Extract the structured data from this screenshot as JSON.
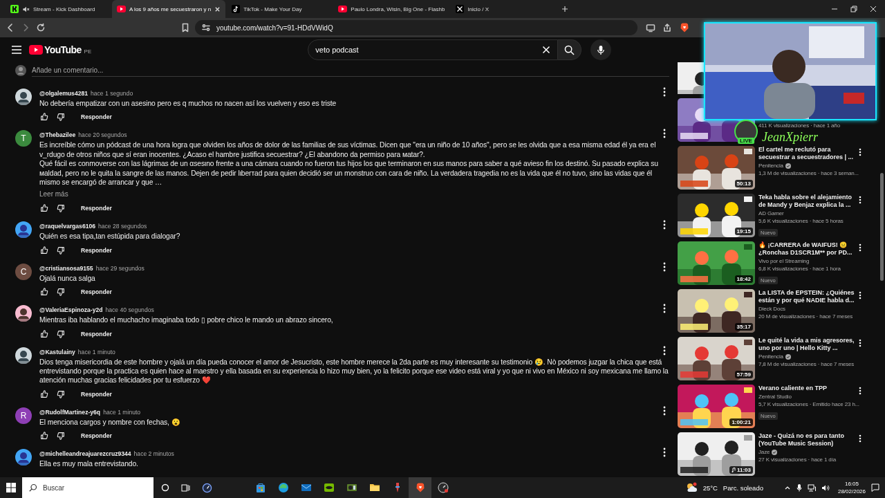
{
  "browser": {
    "tabs": [
      {
        "title": "Stream - Kick Dashboard",
        "kind": "kick",
        "muted": true,
        "selected": false
      },
      {
        "title": "A los 9 años me secuestraron y n",
        "kind": "youtube",
        "muted": false,
        "selected": true
      },
      {
        "title": "TikTok - Make Your Day",
        "kind": "tiktok",
        "muted": false,
        "selected": false
      },
      {
        "title": "Paulo Londra, Wisin, Big One - Flashb",
        "kind": "youtube",
        "muted": false,
        "selected": false
      },
      {
        "title": "Inicio / X",
        "kind": "x",
        "muted": false,
        "selected": false
      }
    ],
    "address": "youtube.com/watch?v=91-HDdVWidQ"
  },
  "youtube": {
    "logo": {
      "text": "YouTube",
      "region": "PE"
    },
    "search": {
      "value": "veto podcast"
    },
    "comment_box": {
      "placeholder": "Añade un comentario..."
    },
    "comments": [
      {
        "author": "@olgalemus4281",
        "time": "hace 1 segundo",
        "text": "No debería empatizar con un asesino pero es q muchos no nacen así los vuelven y eso es triste",
        "reply": "Responder"
      },
      {
        "author": "@Thebazilee",
        "time": "hace 20 segundos",
        "text": "Es increíble cómo un pódcast de una hora logra que olviden los años de dolor de las familias de sus víctimas. Dicen que \"era un niño de 10 años\", pero se les olvida que a esa misma edad él ya era el v_rdugo de otros niños que sí eran inocentes. ¿Acaso el hambre justifica ѕecuеstrar? ¿El abandono da permiso para маtаr?.\nQué fácil es conmoverse con las lágrimas de un αsesιno frente a una cámara cuando no fueron tus hijos los que terminaron en sus manos para saber a qué avieso fin los destinó. Su pasado explica su мaldad, pero no le quita la ѕangre de las manos. Dejen de pedir lιberтad para quien decidió ser un monstruo con cara de niño. La verdadera tragedia no es la vida que él no tuvo, sino las vidas que él mismo se encargó de arrancar y que …",
        "more": "Leer más",
        "avatar": {
          "kind": "letter",
          "letter": "T",
          "color": "#3b8a3e"
        },
        "reply": "Responder"
      },
      {
        "author": "@raquelvargas6106",
        "time": "hace 28 segundos",
        "text": "Quién es esa tipa,tan estúpida para dialogar?",
        "reply": "Responder"
      },
      {
        "author": "@cristiansosa9155",
        "time": "hace 29 segundos",
        "text": "Ojalá nunca salga",
        "avatar": {
          "kind": "letter",
          "letter": "C",
          "color": "#6d4c41"
        },
        "reply": "Responder"
      },
      {
        "author": "@ValeriaEspinoza-y2d",
        "time": "hace 40 segundos",
        "text": "Mientras iba hablando el muchacho  imaginaba todo ▯ pobre chico le mando un abrazo sincero,",
        "reply": "Responder"
      },
      {
        "author": "@Kastulainy",
        "time": "hace 1 minuto",
        "text": "Dios tenga misericordia de este hombre y ojalá un día pueda conocer el amor de Jesucristo,  este hombre merece la 2da parte es muy interesante su testimonio 😢.  Nò podemos juzgar la chica que está entrevistando porque la practica es quien hace al maestro y ella basada en su experiencia lo hizo muy bien, yo la felicito porque ese video está viral y yo que ni vivo en México ni soy mexicana me llamo la atención muchas gracias felicidades por tu esfuerzo ❤️",
        "reply": "Responder"
      },
      {
        "author": "@RudolfMartinez-y6q",
        "time": "hace 1 minuto",
        "text": "El menciona cargos y nombre con fechas, 😮",
        "avatar": {
          "kind": "letter",
          "letter": "R",
          "color": "#8e3fb5"
        },
        "reply": "Responder"
      },
      {
        "author": "@michelleandreajuarezcruz9344",
        "time": "hace 2 minutos",
        "text": "Ella es muy mala entrevistando."
      }
    ]
  },
  "sidebar": {
    "videos": [
      {
        "stats": "411 K visualizaciones · hace 1 año"
      },
      {
        "title": "El cartel me reclutó para secuestrar a secuestradores | ...",
        "channel": "Penitencia",
        "verified": true,
        "stats": "1,3 M de visualizaciones · hace 3 seman...",
        "duration": "50:13"
      },
      {
        "title": "Teka habla sobre el alejamiento de Mandy y Benjaz explica la ...",
        "channel": "AD Gamer",
        "verified": false,
        "stats": "5,6 K visualizaciones · hace 5 horas",
        "duration": "19:15",
        "badge": "Nuevo"
      },
      {
        "title": "🔥 ¡CARRERA de WAIFUS! 😐 ¿Ronchas D1SCR1M** por PD...",
        "channel": "Vivo por el Streaming",
        "verified": false,
        "stats": "6,8 K visualizaciones · hace 1 hora",
        "duration": "18:42",
        "badge": "Nuevo"
      },
      {
        "title": "La LISTA de EPSTEIN: ¿Quiénes están y por qué NADIE habla d...",
        "channel": "Dieck Docs",
        "verified": false,
        "stats": "20 M de visualizaciones · hace 7 meses",
        "duration": "35:17"
      },
      {
        "title": "Le quité la vida a mis agresores, uno por uno | Hello Kitty ...",
        "channel": "Penitencia",
        "verified": true,
        "stats": "7,8 M de visualizaciones · hace 7 meses",
        "duration": "57:59"
      },
      {
        "title": "Verano caliente en TPP",
        "channel": "Zentral Studio",
        "verified": false,
        "stats": "5,7 K visualizaciones · Emitido hace 23 h...",
        "duration": "1:00:21",
        "badge": "Nuevo"
      },
      {
        "title": "Jaze - Quizá no es para tanto (YouTube Music Session)",
        "channel": "Jaze",
        "verified": true,
        "stats": "27 K visualizaciones · hace 1 día",
        "duration": "11:03",
        "music": true
      }
    ]
  },
  "stream_overlay": {
    "name": "JeanXpierr",
    "badge": "LIVE"
  },
  "taskbar": {
    "search_placeholder": "Buscar",
    "apps": [
      {
        "kind": "store",
        "selected": false
      },
      {
        "kind": "edge",
        "selected": false
      },
      {
        "kind": "mail",
        "selected": false
      },
      {
        "kind": "nvidia",
        "selected": false
      },
      {
        "kind": "gpu",
        "selected": false
      },
      {
        "kind": "folder",
        "selected": false
      },
      {
        "kind": "tool",
        "selected": false
      },
      {
        "kind": "brave",
        "selected": true
      },
      {
        "kind": "recorder",
        "selected": false
      }
    ],
    "weather": {
      "temperature": "25°C",
      "condition": "Parc. soleado"
    },
    "time": "16:05",
    "date": "28/02/2026"
  }
}
